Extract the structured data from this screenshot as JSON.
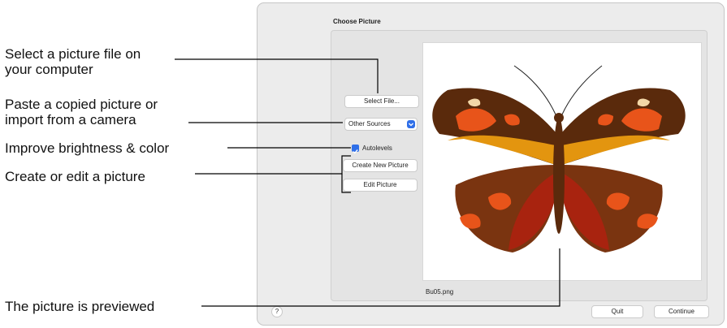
{
  "callouts": {
    "select_file_line1": "Select a picture file on",
    "select_file_line2": "your computer",
    "other_sources_line1": "Paste a copied picture or",
    "other_sources_line2": "import from a camera",
    "autolevels": "Improve brightness & color",
    "create_edit": "Create or edit a picture",
    "preview": "The picture is previewed"
  },
  "dialog": {
    "title": "Choose Picture",
    "select_file_label": "Select File...",
    "other_sources_label": "Other Sources",
    "autolevels_label": "Autolevels",
    "autolevels_checked": true,
    "create_new_label": "Create New Picture",
    "edit_picture_label": "Edit Picture",
    "filename": "Bu05.png",
    "help_label": "?",
    "quit_label": "Quit",
    "continue_label": "Continue"
  },
  "preview_image": {
    "subject": "butterfly",
    "colors": {
      "dark_brown": "#5a2a0c",
      "brown": "#7a3410",
      "orange": "#e8541a",
      "amber": "#e3950f",
      "red": "#a8230f",
      "tan": "#f3d8a8"
    }
  },
  "accent_color": "#2f6fe8"
}
